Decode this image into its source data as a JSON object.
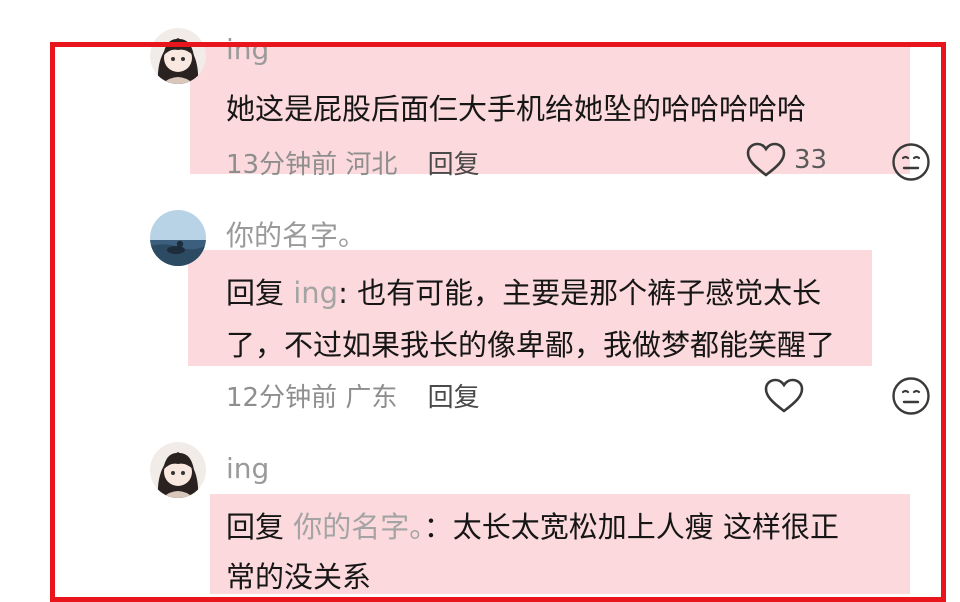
{
  "comments": [
    {
      "username": "ing",
      "text": "她这是屁股后面仨大手机给她坠的哈哈哈哈哈",
      "time": "13分钟前",
      "location": "河北",
      "reply_label": "回复",
      "likes": "33",
      "avatar_icon": "girl-avatar-icon"
    },
    {
      "username": "你的名字。",
      "reply_prefix": "回复",
      "reply_to": "ing",
      "colon": ":",
      "text_line1": " 也有可能，主要是那个裤子感觉太长",
      "text_line2": "了，不过如果我长的像卑鄙，我做梦都能笑醒了",
      "time": "12分钟前",
      "location": "广东",
      "reply_label": "回复",
      "avatar_icon": "seaside-avatar-icon"
    },
    {
      "username": "ing",
      "reply_prefix": "回复",
      "reply_to": "你的名字。",
      "colon": "：",
      "text_line1": "太长太宽松加上人瘦 这样很正",
      "text_line2": "常的没关系",
      "avatar_icon": "girl-avatar-icon"
    }
  ],
  "colors": {
    "frame": "#e8151c",
    "highlight": "#fbd9dc"
  }
}
